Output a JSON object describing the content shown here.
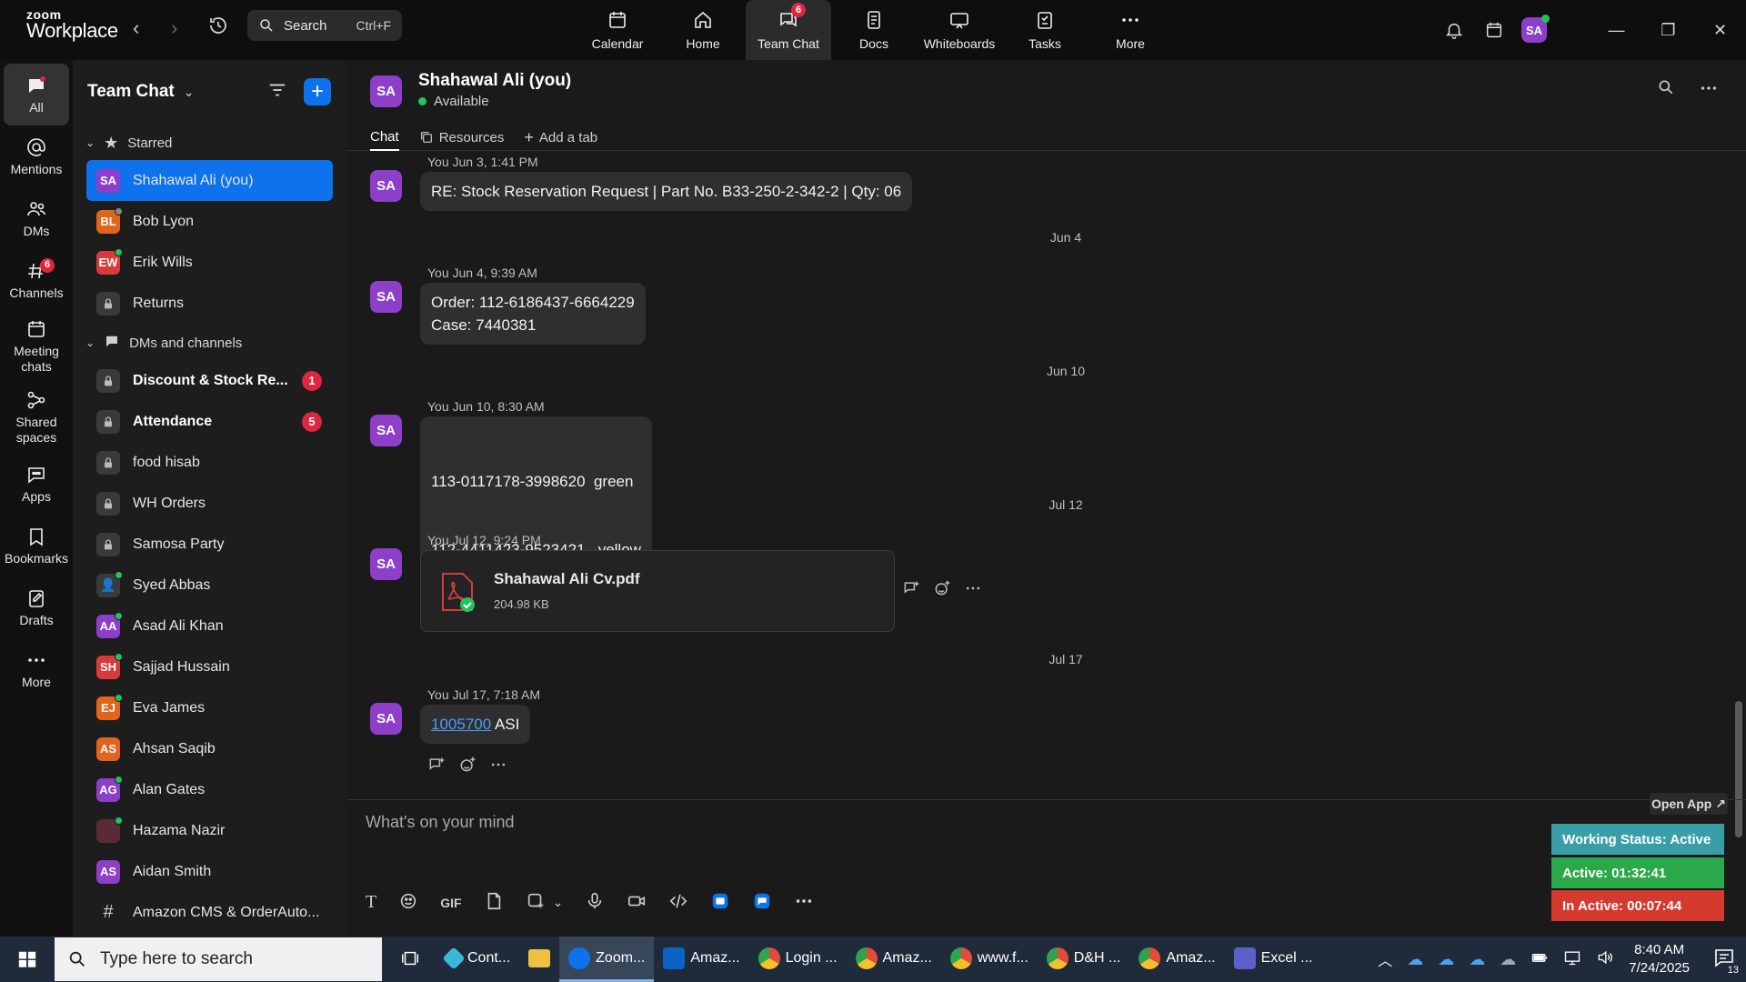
{
  "app": {
    "brand_top": "zoom",
    "brand_bottom": "Workplace"
  },
  "search": {
    "label": "Search",
    "shortcut": "Ctrl+F"
  },
  "topnav": [
    {
      "label": "Calendar"
    },
    {
      "label": "Home"
    },
    {
      "label": "Team Chat",
      "badge": "6"
    },
    {
      "label": "Docs"
    },
    {
      "label": "Whiteboards"
    },
    {
      "label": "Tasks"
    },
    {
      "label": "More"
    }
  ],
  "user": {
    "initials": "SA"
  },
  "rail": [
    {
      "label": "All"
    },
    {
      "label": "Mentions"
    },
    {
      "label": "DMs"
    },
    {
      "label": "Channels",
      "badge": "6"
    },
    {
      "label": "Meeting chats"
    },
    {
      "label": "Shared spaces"
    },
    {
      "label": "Apps"
    },
    {
      "label": "Bookmarks"
    },
    {
      "label": "Drafts"
    },
    {
      "label": "More"
    }
  ],
  "sidebar": {
    "title": "Team Chat",
    "starred_label": "Starred",
    "starred": [
      {
        "initials": "SA",
        "name": "Shahawal Ali (you)",
        "color": "#8d3fc9"
      },
      {
        "initials": "BL",
        "name": "Bob Lyon",
        "color": "#e0641b"
      },
      {
        "initials": "EW",
        "name": "Erik Wills",
        "color": "#d83b3b"
      },
      {
        "name": "Returns"
      }
    ],
    "dms_label": "DMs and channels",
    "dms": [
      {
        "name": "Discount & Stock Re...",
        "badge": "1"
      },
      {
        "name": "Attendance",
        "badge": "5"
      },
      {
        "name": "food hisab"
      },
      {
        "name": "WH Orders"
      },
      {
        "name": "Samosa Party"
      },
      {
        "initials": "",
        "name": "Syed Abbas",
        "color": "#3a3a3a"
      },
      {
        "initials": "AA",
        "name": "Asad Ali Khan",
        "color": "#8d3fc9"
      },
      {
        "initials": "SH",
        "name": "Sajjad Hussain",
        "color": "#d83b3b"
      },
      {
        "initials": "EJ",
        "name": "Eva James",
        "color": "#e0641b"
      },
      {
        "initials": "AS",
        "name": "Ahsan Saqib",
        "color": "#e0641b"
      },
      {
        "initials": "AG",
        "name": "Alan Gates",
        "color": "#8d3fc9"
      },
      {
        "initials": "",
        "name": "Hazama Nazir",
        "color": "#5a2a35"
      },
      {
        "initials": "AS",
        "name": "Aidan Smith",
        "color": "#8d3fc9"
      },
      {
        "name": "Amazon CMS & OrderAuto..."
      }
    ]
  },
  "chat": {
    "initials": "SA",
    "name": "Shahawal Ali (you)",
    "status": "Available",
    "tabs": [
      "Chat",
      "Resources",
      "Add a tab"
    ]
  },
  "messages": {
    "m1": {
      "meta": "You Jun 3, 1:41 PM",
      "text": "RE: Stock Reservation Request | Part No. B33-250-2-342-2 | Qty: 06"
    },
    "d1": "Jun 4",
    "m2": {
      "meta": "You Jun 4, 9:39 AM",
      "line1": "Order: 112-6186437-6664229",
      "line2": "Case: 7440381"
    },
    "d2": "Jun 10",
    "m3": {
      "meta": "You Jun 10, 8:30 AM",
      "line1": "113-0117178-3998620  green",
      "line2": "112-4411423-9523421   yellow"
    },
    "d3": "Jul 12",
    "m4": {
      "meta": "You Jul 12, 9:24 PM",
      "file_name": "Shahawal Ali Cv.pdf",
      "file_size": "204.98 KB"
    },
    "d4": "Jul 17",
    "m5": {
      "meta": "You Jul 17, 7:18 AM",
      "link": "1005700",
      "text": " ASI"
    }
  },
  "compose": {
    "placeholder": "What's on your mind",
    "gif": "GIF"
  },
  "widget": {
    "open_app": "Open App ↗",
    "working": "Working Status: Active",
    "active": "Active: 01:32:41",
    "inactive": "In Active: 00:07:44",
    "colors": {
      "working": "#3a9ea8",
      "active": "#2aa84a",
      "inactive": "#d43a2e"
    }
  },
  "taskbar": {
    "search": "Type here to search",
    "apps": [
      {
        "label": "Cont...",
        "color": "#3bb8d8"
      },
      {
        "label": "",
        "color": "#f0c040"
      },
      {
        "label": "Zoom...",
        "color": "#0e72ed",
        "active": true
      },
      {
        "label": "Amaz...",
        "color": "#0a64c8"
      },
      {
        "label": "Login ...",
        "color": "#e34b3b"
      },
      {
        "label": "Amaz...",
        "color": "#e34b3b"
      },
      {
        "label": "www.f...",
        "color": "#e34b3b"
      },
      {
        "label": "D&H ...",
        "color": "#e34b3b"
      },
      {
        "label": "Amaz...",
        "color": "#e34b3b"
      },
      {
        "label": "Excel ...",
        "color": "#5b5fc7"
      }
    ],
    "time": "8:40 AM",
    "date": "7/24/2025",
    "notif": "13"
  }
}
